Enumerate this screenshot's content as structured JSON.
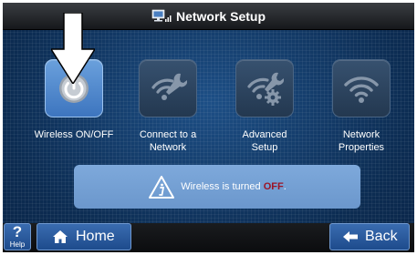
{
  "header": {
    "title": "Network Setup",
    "icon": "network-computer-icon"
  },
  "tiles": [
    {
      "label_line1": "Wireless ON/OFF",
      "label_line2": "",
      "icon": "power-icon",
      "state": "active"
    },
    {
      "label_line1": "Connect to a",
      "label_line2": "Network",
      "icon": "wifi-wrench-icon",
      "state": "normal"
    },
    {
      "label_line1": "Advanced",
      "label_line2": "Setup",
      "icon": "wifi-wrench-gear-icon",
      "state": "normal"
    },
    {
      "label_line1": "Network",
      "label_line2": "Properties",
      "icon": "wifi-icon",
      "state": "normal"
    }
  ],
  "status": {
    "text_prefix": "Wireless is turned ",
    "text_state": "OFF",
    "text_suffix": ".",
    "icon": "info-icon"
  },
  "footer": {
    "help_symbol": "?",
    "help_label": "Help",
    "home_label": "Home",
    "back_label": "Back"
  },
  "colors": {
    "background": "#0d2f57",
    "active_tile": "#5a92d4",
    "status_panel": "#7ba6d8",
    "off_text": "#9c1426",
    "button": "#2d5ea0"
  }
}
